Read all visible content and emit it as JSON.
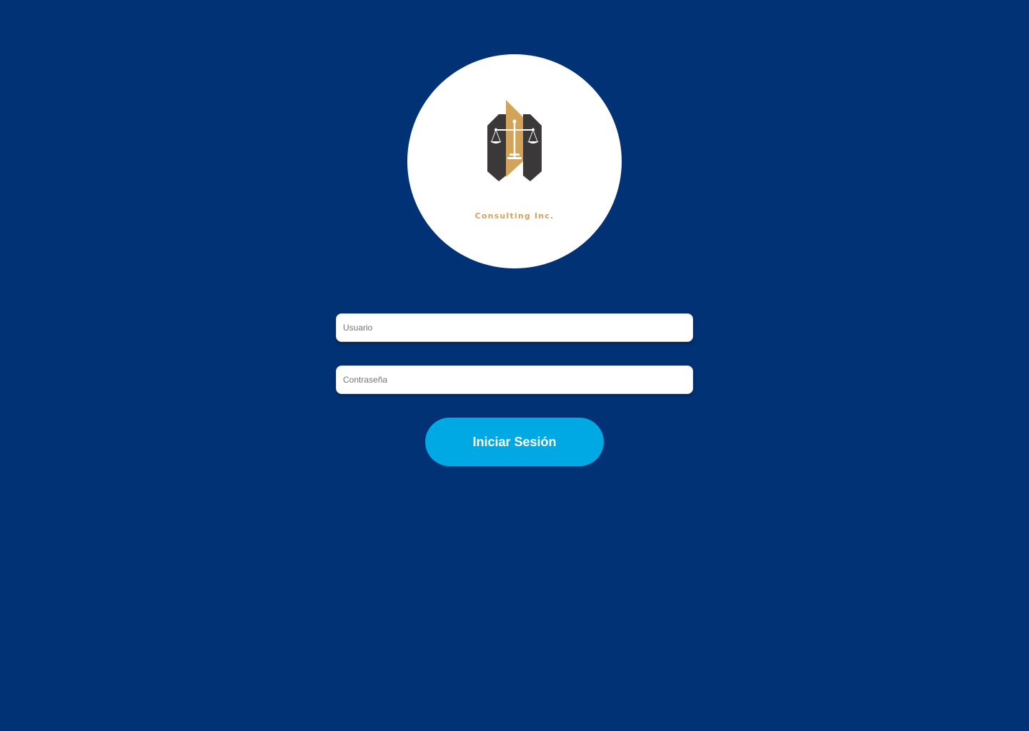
{
  "logo": {
    "company_name": "Consulting Inc.",
    "icon": "scales-of-justice-building-logo",
    "colors": {
      "gold": "#d4a35a",
      "dark": "#3a3838"
    }
  },
  "login_form": {
    "username_placeholder": "Usuario",
    "username_value": "",
    "password_placeholder": "Contraseña",
    "password_value": "",
    "submit_label": "Iniciar Sesión"
  },
  "colors": {
    "background": "#003275",
    "button": "#00a9e3",
    "button_text": "#ffffff"
  }
}
